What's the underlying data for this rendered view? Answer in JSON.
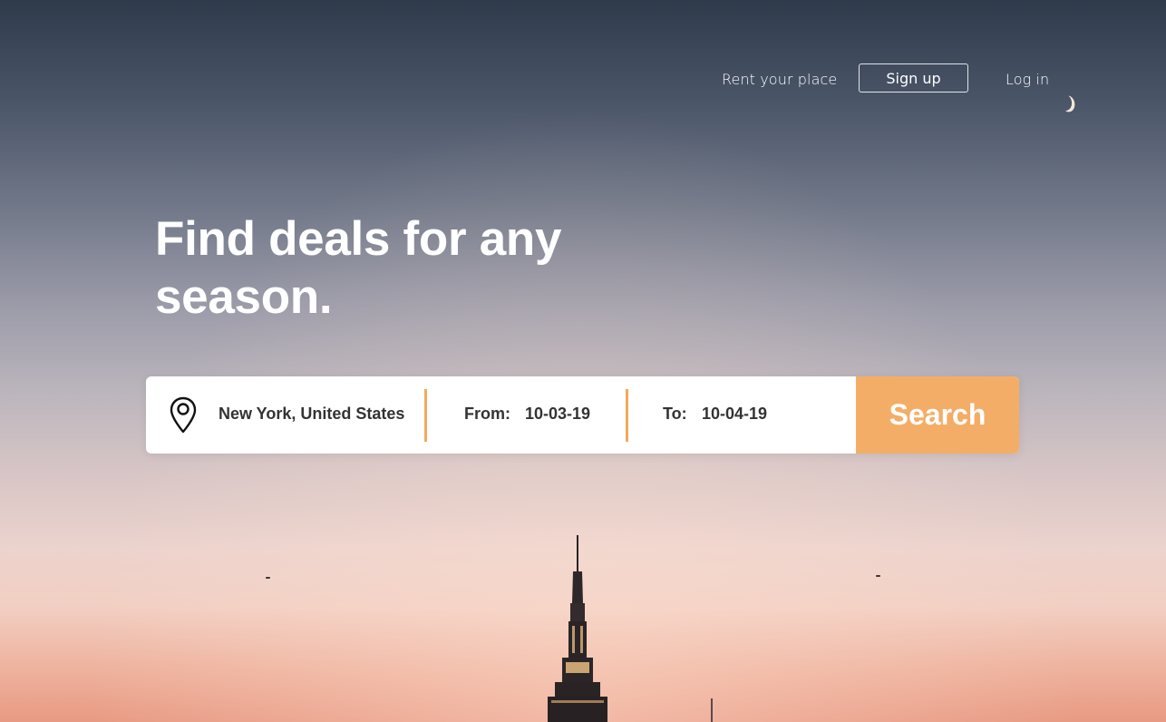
{
  "nav": {
    "rent_label": "Rent your place",
    "signup_label": "Sign up",
    "login_label": "Log in"
  },
  "hero": {
    "headline_line1": "Find deals for any",
    "headline_line2": "season."
  },
  "search": {
    "location_value": "New York, United States",
    "location_icon": "map-pin-icon",
    "from_label": "From:",
    "from_value": "10-03-19",
    "to_label": "To:",
    "to_value": "10-04-19",
    "search_label": "Search"
  },
  "colors": {
    "accent": "#f4ad67",
    "divider": "#f2a95e",
    "text_dark": "#333333"
  }
}
